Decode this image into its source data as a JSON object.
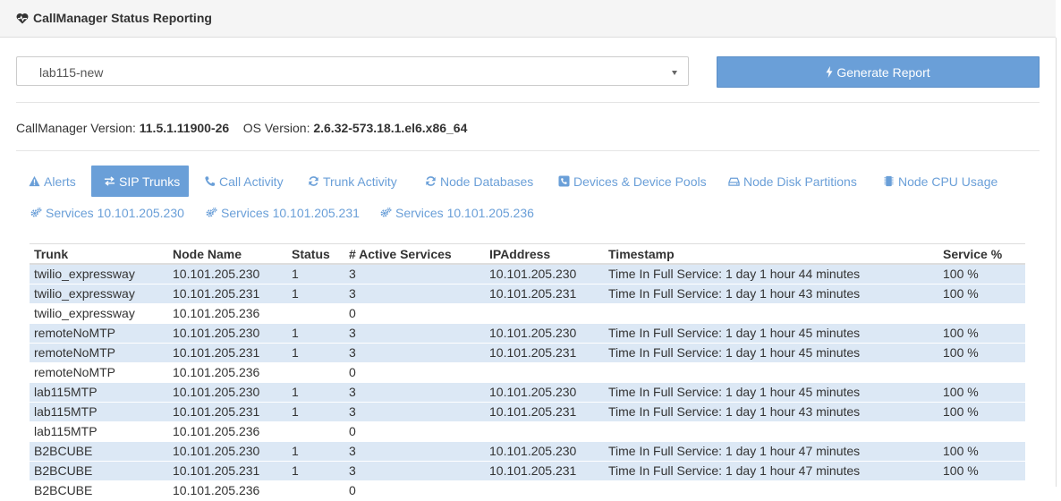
{
  "header": {
    "title": "CallManager Status Reporting",
    "icon": "heartbeat-icon"
  },
  "cluster_select": {
    "value": "lab115-new"
  },
  "generate_button": {
    "label": "Generate Report",
    "icon": "bolt-icon"
  },
  "versions": {
    "cm_label": "CallManager Version:",
    "cm_value": "11.5.1.11900-26",
    "os_label": "OS Version:",
    "os_value": "2.6.32-573.18.1.el6.x86_64"
  },
  "tabs": [
    {
      "label": "Alerts",
      "icon": "warning-icon"
    },
    {
      "label": "SIP Trunks",
      "icon": "exchange-icon",
      "active": true
    },
    {
      "label": "Call Activity",
      "icon": "phone-icon"
    },
    {
      "label": "Trunk Activity",
      "icon": "refresh-icon"
    },
    {
      "label": "Node Databases",
      "icon": "refresh-icon"
    },
    {
      "label": "Devices & Device Pools",
      "icon": "phone-square-icon"
    },
    {
      "label": "Node Disk Partitions",
      "icon": "hdd-icon"
    },
    {
      "label": "Node CPU Usage",
      "icon": "microchip-icon"
    },
    {
      "label": "Services 10.101.205.230",
      "icon": "gears-icon"
    },
    {
      "label": "Services 10.101.205.231",
      "icon": "gears-icon"
    },
    {
      "label": "Services 10.101.205.236",
      "icon": "gears-icon"
    }
  ],
  "table": {
    "columns": [
      "Trunk",
      "Node Name",
      "Status",
      "# Active Services",
      "IPAddress",
      "Timestamp",
      "Service %"
    ],
    "rows": [
      [
        "twilio_expressway",
        "10.101.205.230",
        "1",
        "3",
        "10.101.205.230",
        "Time In Full Service: 1 day 1 hour 44 minutes",
        "100 %"
      ],
      [
        "twilio_expressway",
        "10.101.205.231",
        "1",
        "3",
        "10.101.205.231",
        "Time In Full Service: 1 day 1 hour 43 minutes",
        "100 %"
      ],
      [
        "twilio_expressway",
        "10.101.205.236",
        "",
        "0",
        "",
        "",
        ""
      ],
      [
        "remoteNoMTP",
        "10.101.205.230",
        "1",
        "3",
        "10.101.205.230",
        "Time In Full Service: 1 day 1 hour 45 minutes",
        "100 %"
      ],
      [
        "remoteNoMTP",
        "10.101.205.231",
        "1",
        "3",
        "10.101.205.231",
        "Time In Full Service: 1 day 1 hour 45 minutes",
        "100 %"
      ],
      [
        "remoteNoMTP",
        "10.101.205.236",
        "",
        "0",
        "",
        "",
        ""
      ],
      [
        "lab115MTP",
        "10.101.205.230",
        "1",
        "3",
        "10.101.205.230",
        "Time In Full Service: 1 day 1 hour 45 minutes",
        "100 %"
      ],
      [
        "lab115MTP",
        "10.101.205.231",
        "1",
        "3",
        "10.101.205.231",
        "Time In Full Service: 1 day 1 hour 43 minutes",
        "100 %"
      ],
      [
        "lab115MTP",
        "10.101.205.236",
        "",
        "0",
        "",
        "",
        ""
      ],
      [
        "B2BCUBE",
        "10.101.205.230",
        "1",
        "3",
        "10.101.205.230",
        "Time In Full Service: 1 day 1 hour 47 minutes",
        "100 %"
      ],
      [
        "B2BCUBE",
        "10.101.205.231",
        "1",
        "3",
        "10.101.205.231",
        "Time In Full Service: 1 day 1 hour 47 minutes",
        "100 %"
      ],
      [
        "B2BCUBE",
        "10.101.205.236",
        "",
        "0",
        "",
        "",
        ""
      ]
    ]
  },
  "colors": {
    "accent": "#6a9fd8",
    "row_highlight": "#dce8f5"
  }
}
